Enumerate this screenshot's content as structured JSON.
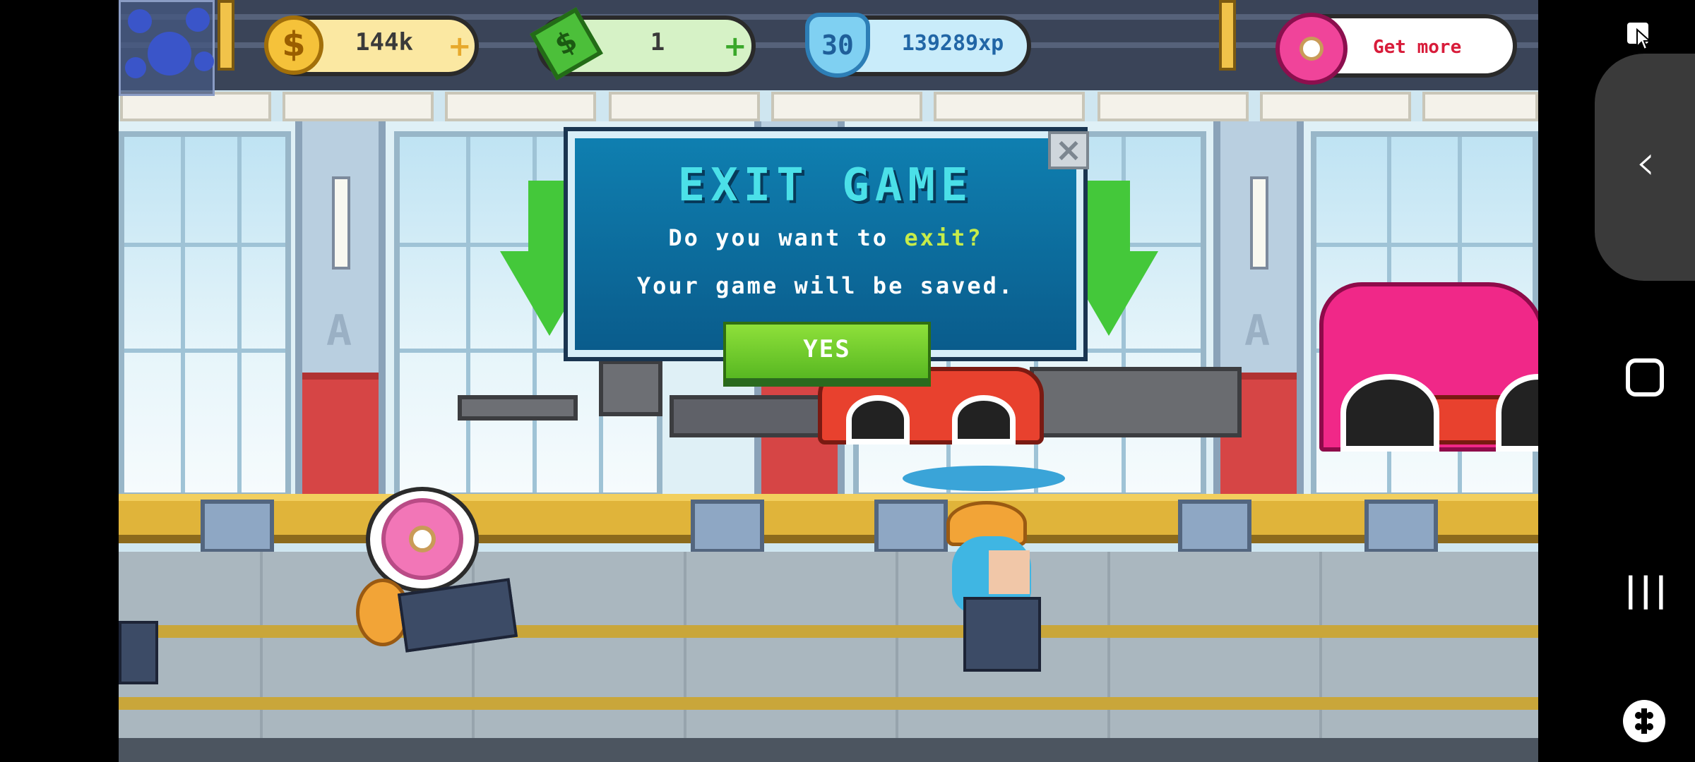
{
  "hud": {
    "coins": "144k",
    "cash": "1",
    "xp_level": "30",
    "xp": "139289xp",
    "get_more": "Get more",
    "coin_symbol": "$",
    "plus": "+"
  },
  "dialog": {
    "title": "EXIT GAME",
    "line1_prefix": "Do you want to ",
    "line1_highlight": "exit?",
    "line2": "Your game will be saved.",
    "yes": "YES",
    "close": "×"
  },
  "scene": {
    "pillar_letter": "A"
  },
  "nav": {
    "back": "‹",
    "home": "▢",
    "recents": "|||"
  },
  "colors": {
    "dialog_bg": "#0a5c8c",
    "title": "#4be0e8",
    "highlight": "#c6ec4a",
    "yes_button": "#6ccc2e",
    "coin_pill": "#fbe8a2",
    "cash_pill": "#d6f2c6",
    "xp_pill": "#c9ecfa"
  }
}
